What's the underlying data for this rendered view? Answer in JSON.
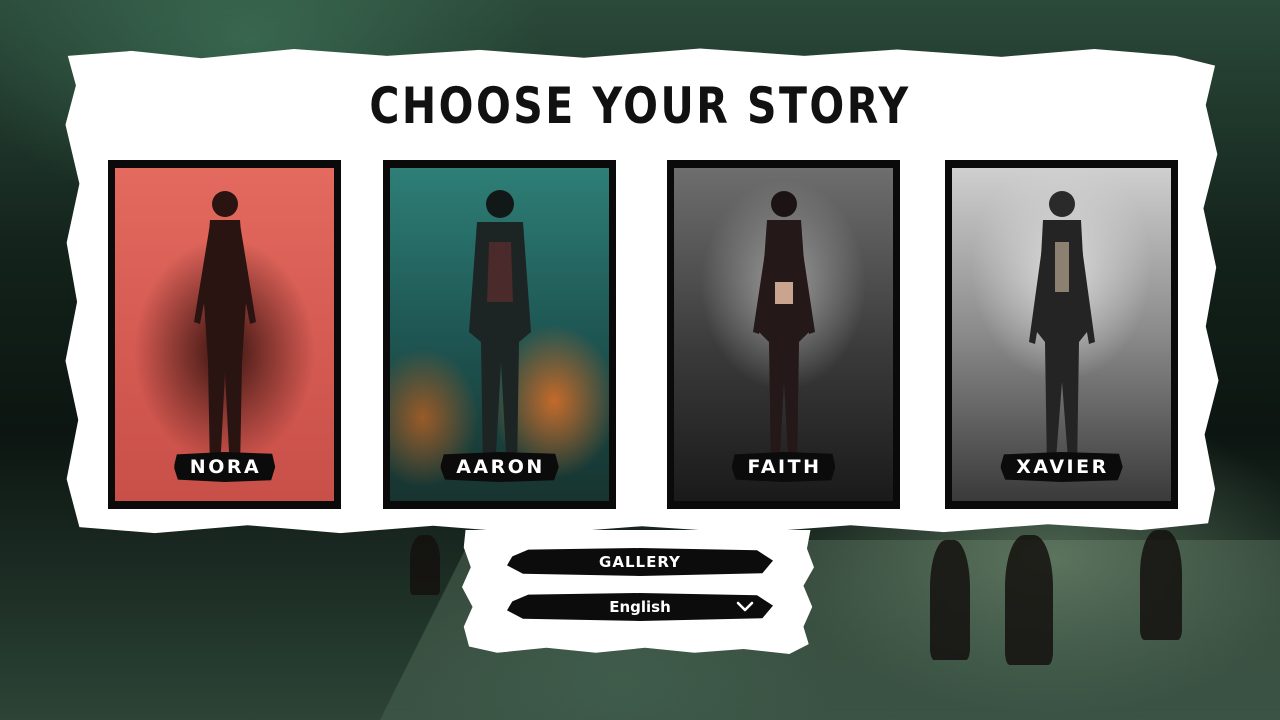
{
  "screen": {
    "title": "CHOOSE YOUR STORY"
  },
  "characters": [
    {
      "name": "NORA",
      "theme_color": "#e46a5f",
      "theme_dark": "#241010"
    },
    {
      "name": "AARON",
      "theme_color": "#2f8a7f",
      "theme_dark": "#0f2a2c"
    },
    {
      "name": "FAITH",
      "theme_color": "#8c8c8c",
      "theme_dark": "#151515"
    },
    {
      "name": "XAVIER",
      "theme_color": "#c9c9c9",
      "theme_dark": "#2a2a2a"
    }
  ],
  "menu": {
    "gallery_label": "GALLERY",
    "language": {
      "selected": "English",
      "icon": "chevron-down-icon"
    }
  },
  "colors": {
    "panel": "#ffffff",
    "button_bg": "#0c0c0c",
    "title_text": "#111111"
  }
}
